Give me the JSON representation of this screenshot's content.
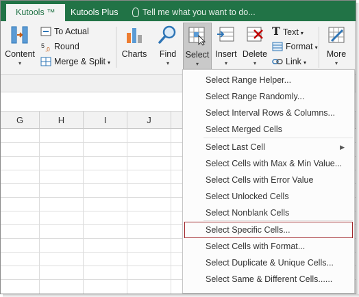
{
  "tabs": {
    "kutools": "Kutools ™",
    "kutools_plus": "Kutools Plus",
    "tell_me": "Tell me what you want to do..."
  },
  "ribbon": {
    "content": "Content",
    "to_actual": "To Actual",
    "round": "Round",
    "merge_split": "Merge & Split",
    "charts": "Charts",
    "find": "Find",
    "select": "Select",
    "insert": "Insert",
    "delete": "Delete",
    "text": "Text",
    "format": "Format",
    "link": "Link",
    "more": "More"
  },
  "columns": [
    "G",
    "H",
    "I",
    "J"
  ],
  "menu": {
    "items": [
      "Select Range Helper...",
      "Select Range Randomly...",
      "Select Interval Rows & Columns...",
      "Select Merged Cells",
      "Select Last Cell",
      "Select Cells with Max & Min Value...",
      "Select Cells with Error Value",
      "Select Unlocked Cells",
      "Select Nonblank Cells",
      "Select Specific Cells...",
      "Select Cells with Format...",
      "Select Duplicate & Unique Cells...",
      "Select Same & Different Cells......"
    ],
    "highlighted": "Select Specific Cells..."
  },
  "colors": {
    "accent": "#217346",
    "highlight_border": "#a0272b"
  }
}
